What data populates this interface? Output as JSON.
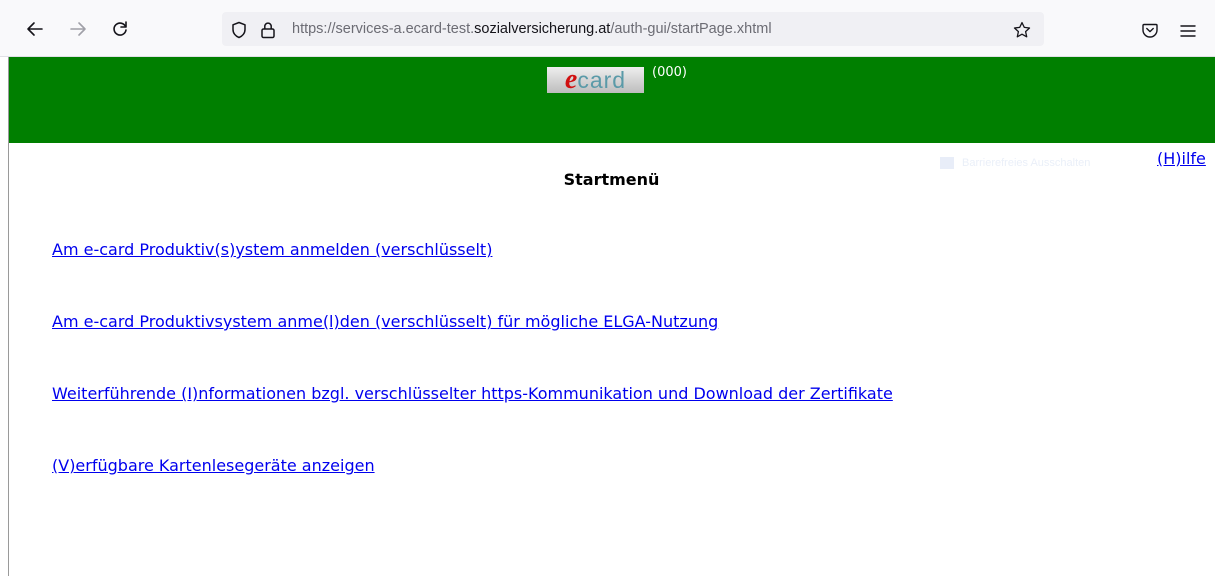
{
  "browser": {
    "url_prefix": "https://services-a.ecard-test.",
    "url_host": "sozialversicherung.at",
    "url_path": "/auth-gui/startPage.xhtml"
  },
  "header": {
    "logo_e": "e",
    "logo_card": "card",
    "code": "(000)",
    "bg_color": "#007f00"
  },
  "help_label": "(H)ilfe",
  "ghost_label": "Barrierefreies Ausschalten",
  "title": "Startmenü",
  "links": [
    {
      "label": "Am e-card Produktiv(s)ystem anmelden (verschlüsselt)"
    },
    {
      "label": "Am e-card Produktivsystem anme(l)den (verschlüsselt) für mögliche ELGA-Nutzung"
    },
    {
      "label": "Weiterführende (I)nformationen bzgl. verschlüsselter https-Kommunikation und Download der Zertifikate"
    },
    {
      "label": "(V)erfügbare Kartenlesegeräte anzeigen"
    }
  ],
  "icons": [
    "back-arrow-icon",
    "forward-arrow-icon",
    "reload-icon",
    "shield-icon",
    "lock-icon",
    "star-icon",
    "pocket-icon",
    "hamburger-menu-icon"
  ]
}
